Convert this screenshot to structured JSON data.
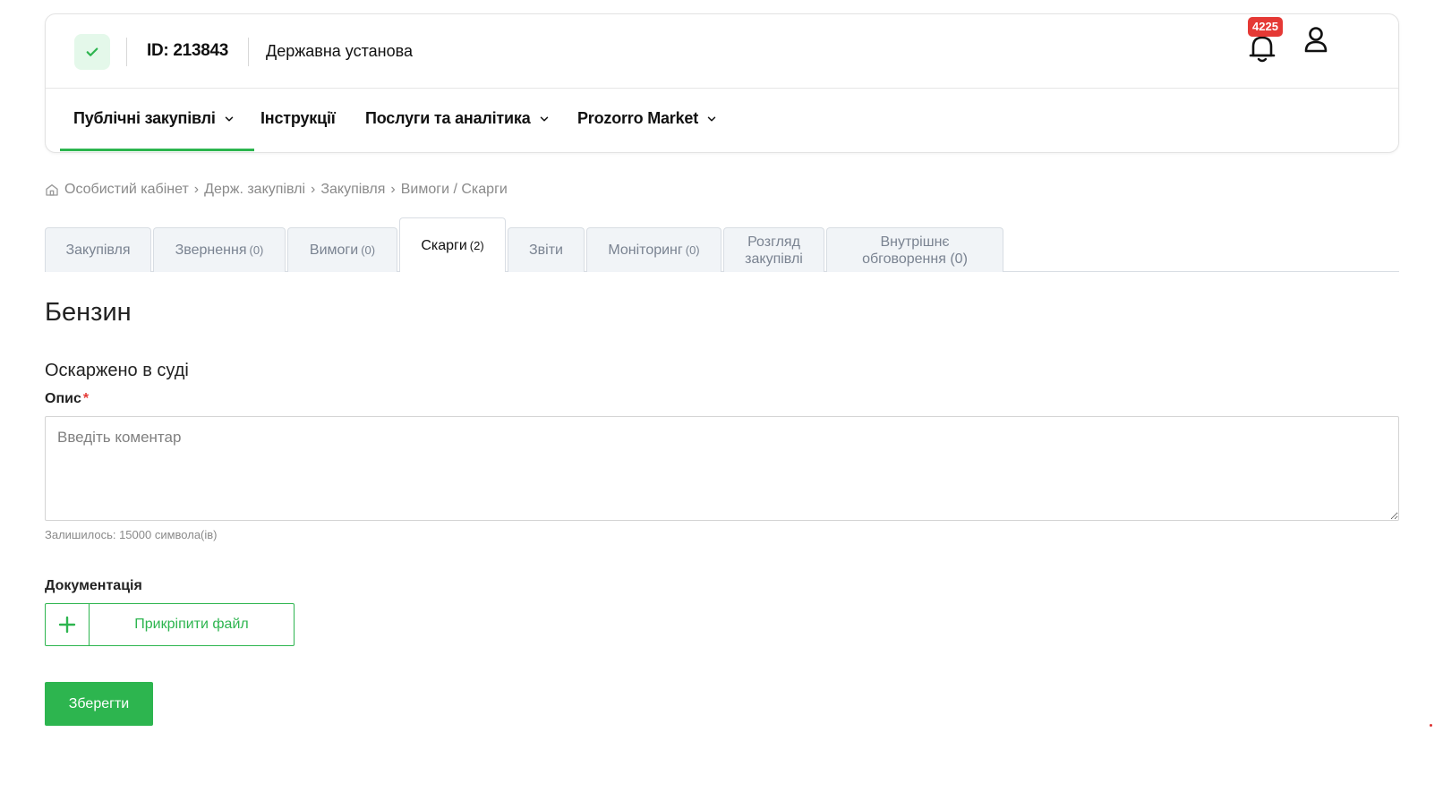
{
  "header": {
    "org_id": "ID: 213843",
    "org_name": "Державна установа",
    "notifications_count": "4225",
    "icons": {
      "verified": "check-icon",
      "bell": "bell-icon",
      "user": "user-icon"
    }
  },
  "nav": {
    "items": [
      {
        "label": "Публічні закупівлі",
        "has_dropdown": true,
        "active": true
      },
      {
        "label": "Інструкції",
        "has_dropdown": false
      },
      {
        "label": "Послуги та аналітика",
        "has_dropdown": true
      },
      {
        "label": "Prozorro Market",
        "has_dropdown": true
      }
    ]
  },
  "breadcrumb": {
    "icon": "home-icon",
    "items": [
      "Особистий кабінет",
      "›",
      "Держ. закупівлі",
      "›",
      "Закупівля",
      "›",
      "Вимоги / Скарги"
    ]
  },
  "tabs": [
    {
      "label": "Закупівля",
      "count": ""
    },
    {
      "label": "Звернення",
      "count": "(0)"
    },
    {
      "label": "Вимоги",
      "count": "(0)"
    },
    {
      "label": "Скарги",
      "count": "(2)",
      "active": true
    },
    {
      "label": "Звіти",
      "count": ""
    },
    {
      "label": "Моніторинг",
      "count": "(0)"
    },
    {
      "label": "Розгляд закупівлі",
      "count": ""
    },
    {
      "label": "Внутрішнє обговорення (0)",
      "count": ""
    }
  ],
  "main": {
    "title": "Бензин",
    "status": "Оскаржено в суді",
    "description_label": "Опис",
    "required_mark": "*",
    "description_placeholder": "Введіть коментар",
    "description_value": "",
    "chars_left": "Залишилось: 15000 символа(ів)",
    "docs_label": "Документація",
    "attach_label": "Прикріпити файл",
    "save_label": "Зберегти"
  },
  "colors": {
    "accent": "#2db54f",
    "badge": "#e53935",
    "verified_bg": "#e4f8ea",
    "tab_bg": "#f1f4f7"
  }
}
